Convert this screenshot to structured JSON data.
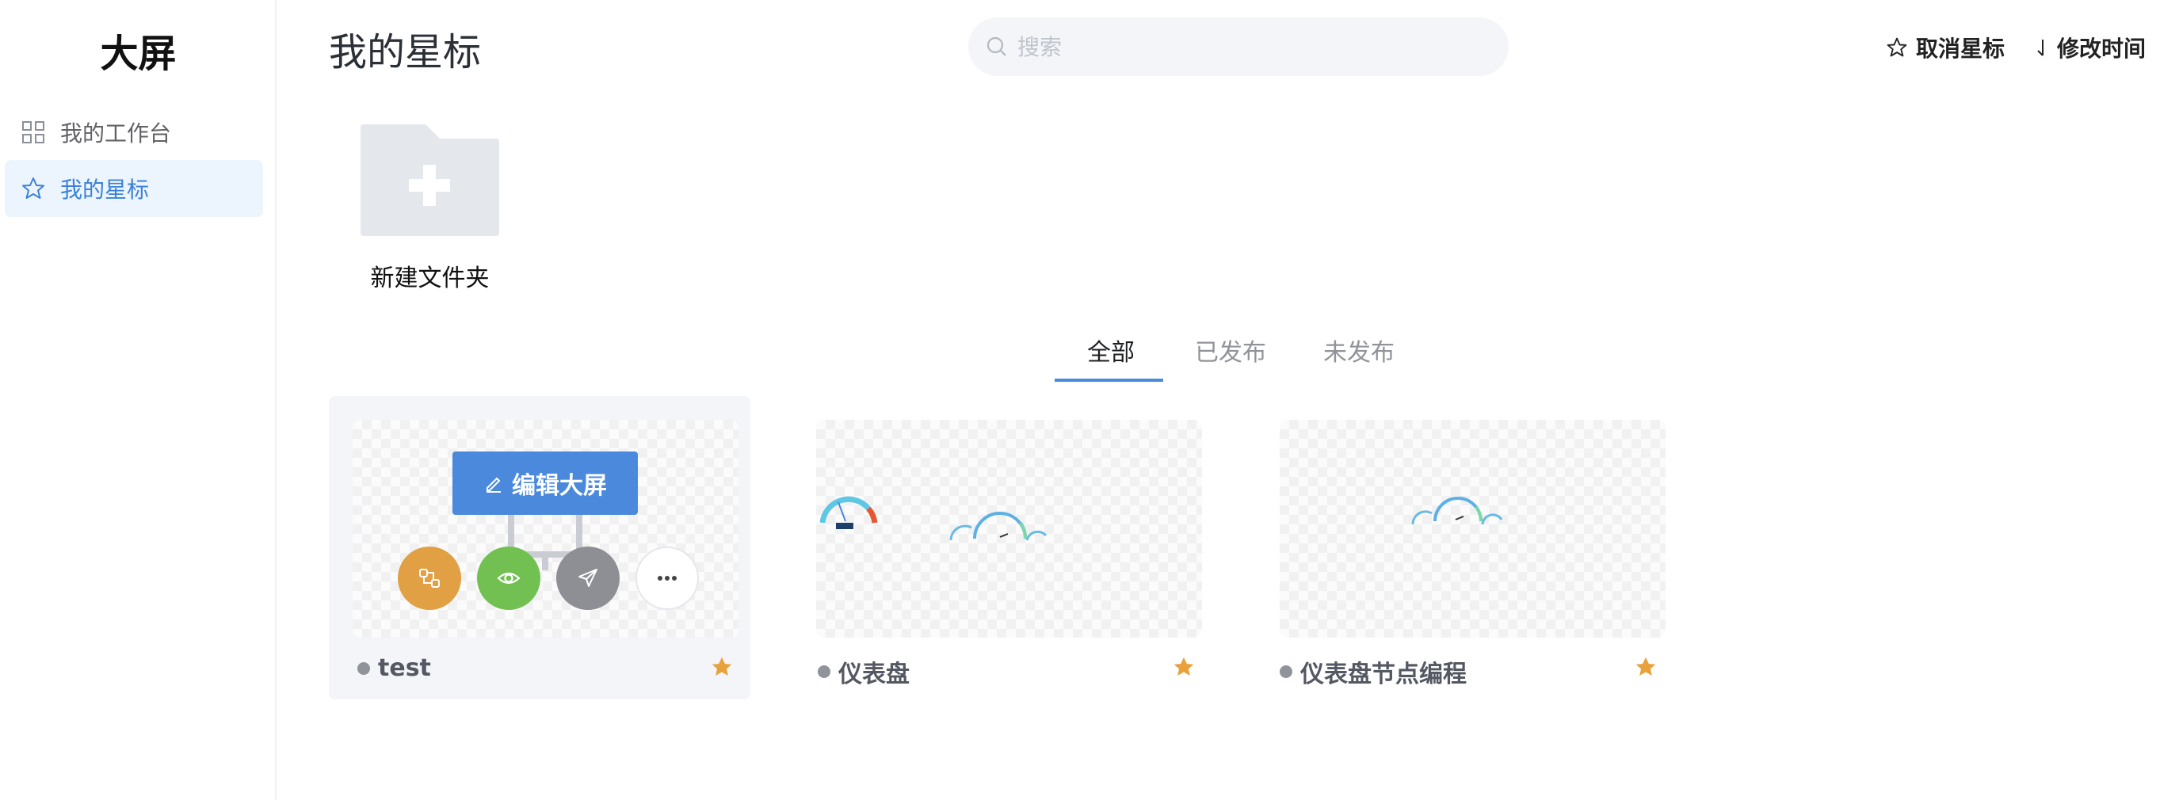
{
  "sidebar": {
    "logo": "大屏",
    "items": [
      {
        "label": "我的工作台",
        "icon": "grid-icon",
        "active": false
      },
      {
        "label": "我的星标",
        "icon": "star-icon",
        "active": true
      }
    ]
  },
  "header": {
    "title": "我的星标",
    "search": {
      "placeholder": "搜索",
      "value": ""
    },
    "unstar_label": "取消星标",
    "sort_label": "修改时间"
  },
  "new_folder": {
    "label": "新建文件夹"
  },
  "tabs": [
    {
      "label": "全部",
      "active": true
    },
    {
      "label": "已发布",
      "active": false
    },
    {
      "label": "未发布",
      "active": false
    }
  ],
  "cards": [
    {
      "name": "test",
      "starred": true,
      "hovered": true,
      "edit_label": "编辑大屏"
    },
    {
      "name": "仪表盘",
      "starred": true,
      "hovered": false
    },
    {
      "name": "仪表盘节点编程",
      "starred": true,
      "hovered": false
    }
  ],
  "colors": {
    "accent": "#4a89dc",
    "active_nav_bg": "#ecf4fd",
    "star": "#e9a23b",
    "flow_button": "#e0a043",
    "preview_button": "#72c051",
    "publish_button": "#8d8f94"
  }
}
